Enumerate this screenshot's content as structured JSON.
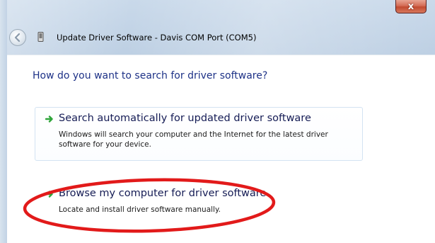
{
  "window": {
    "title": "Update Driver Software - Davis COM Port (COM5)",
    "close_symbol": "x"
  },
  "icons": {
    "close": "close-icon",
    "back": "back-arrow-icon",
    "device": "device-icon",
    "option_arrow": "green-arrow-icon"
  },
  "content": {
    "question": "How do you want to search for driver software?",
    "options": [
      {
        "title": "Search automatically for updated driver software",
        "description": "Windows will search your computer and the Internet for the latest driver software for your device."
      },
      {
        "title": "Browse my computer for driver software",
        "description": "Locate and install driver software manually."
      }
    ]
  },
  "colors": {
    "heading": "#1e3287",
    "option_title": "#151c55",
    "arrow_green": "#2fa53a",
    "annotation_red": "#e21a1a"
  }
}
